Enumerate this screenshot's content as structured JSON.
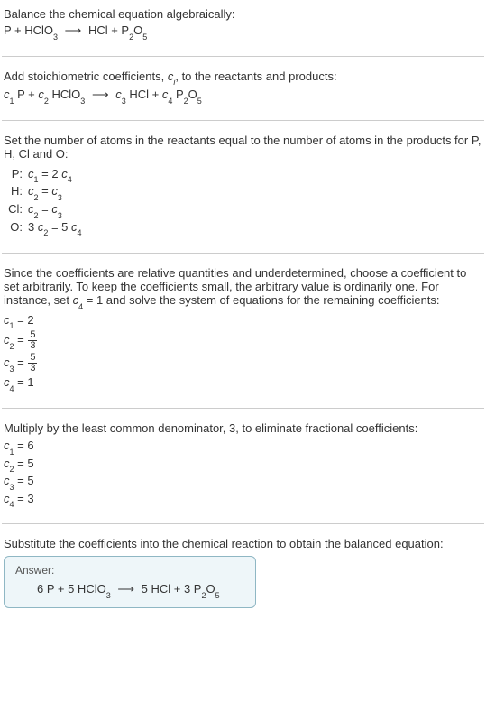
{
  "intro": {
    "line1": "Balance the chemical equation algebraically:",
    "eq_left_p": "P + HClO",
    "eq_left_sub": "3",
    "eq_arrow": "⟶",
    "eq_right_hcl": "HCl + P",
    "eq_right_sub2": "2",
    "eq_right_o": "O",
    "eq_right_sub5": "5"
  },
  "stoich": {
    "text1": "Add stoichiometric coefficients, ",
    "ci_c": "c",
    "ci_i": "i",
    "text2": ", to the reactants and products:",
    "c1": "c",
    "n1": "1",
    "p": " P + ",
    "c2": "c",
    "n2": "2",
    "hclo": " HClO",
    "hclo_sub": "3",
    "arrow": "⟶",
    "c3": "c",
    "n3": "3",
    "hcl": " HCl + ",
    "c4": "c",
    "n4": "4",
    "p2o5_p": " P",
    "p2o5_2": "2",
    "p2o5_o": "O",
    "p2o5_5": "5"
  },
  "atoms": {
    "intro": "Set the number of atoms in the reactants equal to the number of atoms in the products for P, H, Cl and O:",
    "rows": [
      {
        "el": "P:",
        "lhs_c": "c",
        "lhs_n": "1",
        "eq": " = 2 ",
        "rhs_c": "c",
        "rhs_n": "4"
      },
      {
        "el": "H:",
        "lhs_c": "c",
        "lhs_n": "2",
        "eq": " = ",
        "rhs_c": "c",
        "rhs_n": "3"
      },
      {
        "el": "Cl:",
        "lhs_c": "c",
        "lhs_n": "2",
        "eq": " = ",
        "rhs_c": "c",
        "rhs_n": "3"
      },
      {
        "el": "O:",
        "pre": "3 ",
        "lhs_c": "c",
        "lhs_n": "2",
        "eq": " = 5 ",
        "rhs_c": "c",
        "rhs_n": "4"
      }
    ]
  },
  "choose": {
    "para": "Since the coefficients are relative quantities and underdetermined, choose a coefficient to set arbitrarily. To keep the coefficients small, the arbitrary value is ordinarily one. For instance, set ",
    "c4c": "c",
    "c4n": "4",
    "para2": " = 1 and solve the system of equations for the remaining coefficients:",
    "rows": [
      {
        "c": "c",
        "n": "1",
        "eq": " = 2"
      },
      {
        "c": "c",
        "n": "2",
        "eq": " = ",
        "num": "5",
        "den": "3"
      },
      {
        "c": "c",
        "n": "3",
        "eq": " = ",
        "num": "5",
        "den": "3"
      },
      {
        "c": "c",
        "n": "4",
        "eq": " = 1"
      }
    ]
  },
  "lcd": {
    "para": "Multiply by the least common denominator, 3, to eliminate fractional coefficients:",
    "rows": [
      {
        "c": "c",
        "n": "1",
        "eq": " = 6"
      },
      {
        "c": "c",
        "n": "2",
        "eq": " = 5"
      },
      {
        "c": "c",
        "n": "3",
        "eq": " = 5"
      },
      {
        "c": "c",
        "n": "4",
        "eq": " = 3"
      }
    ]
  },
  "final": {
    "para": "Substitute the coefficients into the chemical reaction to obtain the balanced equation:",
    "answer_label": "Answer:",
    "eq_left": "6 P + 5 HClO",
    "eq_left_sub": "3",
    "arrow": "⟶",
    "eq_right_a": "5 HCl + 3 P",
    "eq_right_sub2": "2",
    "eq_right_o": "O",
    "eq_right_sub5": "5"
  }
}
